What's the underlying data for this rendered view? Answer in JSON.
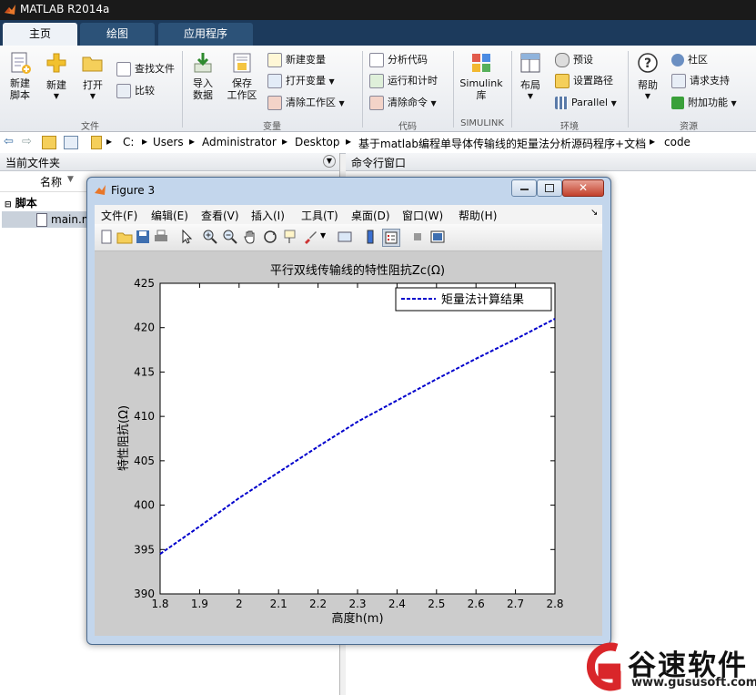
{
  "window": {
    "title": "MATLAB R2014a"
  },
  "tabs": [
    {
      "label": "主页"
    },
    {
      "label": "绘图"
    },
    {
      "label": "应用程序"
    }
  ],
  "ribbon": {
    "file": {
      "new_script": "新建\n脚本",
      "new": "新建",
      "open": "打开",
      "find_files": "查找文件",
      "compare": "比较",
      "group": "文件"
    },
    "variable": {
      "import": "导入\n数据",
      "save_ws": "保存\n工作区",
      "new_var": "新建变量",
      "open_var": "打开变量",
      "clear_ws": "清除工作区",
      "group": "变量"
    },
    "code": {
      "analyze": "分析代码",
      "run_time": "运行和计时",
      "clear_cmd": "清除命令",
      "group": "代码"
    },
    "simulink": {
      "lib": "Simulink\n库",
      "group": "SIMULINK"
    },
    "env": {
      "layout": "布局",
      "prefs": "预设",
      "set_path": "设置路径",
      "parallel": "Parallel",
      "group": "环境"
    },
    "resources": {
      "help": "帮助",
      "community": "社区",
      "support": "请求支持",
      "addons": "附加功能",
      "group": "资源"
    }
  },
  "address": {
    "crumbs": [
      "C:",
      "Users",
      "Administrator",
      "Desktop",
      "基于matlab编程单导体传输线的矩量法分析源码程序+文档",
      "code"
    ]
  },
  "left_panel": {
    "title": "当前文件夹",
    "col_name": "名称",
    "group": "脚本",
    "file": "main.m"
  },
  "right_panel": {
    "title": "命令行窗口"
  },
  "figure": {
    "title": "Figure 3",
    "menu": [
      "文件(F)",
      "编辑(E)",
      "查看(V)",
      "插入(I)",
      "工具(T)",
      "桌面(D)",
      "窗口(W)",
      "帮助(H)"
    ]
  },
  "chart_data": {
    "type": "line",
    "title": "平行双线传输线的特性阻抗Zc(Ω)",
    "xlabel": "高度h(m)",
    "ylabel": "特性阻抗(Ω)",
    "xlim": [
      1.8,
      2.8
    ],
    "ylim": [
      390,
      425
    ],
    "xticks": [
      "1.8",
      "1.9",
      "2",
      "2.1",
      "2.2",
      "2.3",
      "2.4",
      "2.5",
      "2.6",
      "2.7",
      "2.8"
    ],
    "yticks": [
      "390",
      "395",
      "400",
      "405",
      "410",
      "415",
      "420",
      "425"
    ],
    "legend": "top-right",
    "series": [
      {
        "name": "矩量法计算结果",
        "color": "#0000cc",
        "style": "dashed",
        "x": [
          1.8,
          1.9,
          2.0,
          2.1,
          2.2,
          2.3,
          2.4,
          2.5,
          2.6,
          2.7,
          2.8
        ],
        "y": [
          394.5,
          397.6,
          400.8,
          403.7,
          406.6,
          409.4,
          411.8,
          414.2,
          416.5,
          418.7,
          421.0
        ]
      }
    ]
  },
  "watermark": {
    "brand": "谷速软件",
    "url": "www.gususoft.com"
  }
}
